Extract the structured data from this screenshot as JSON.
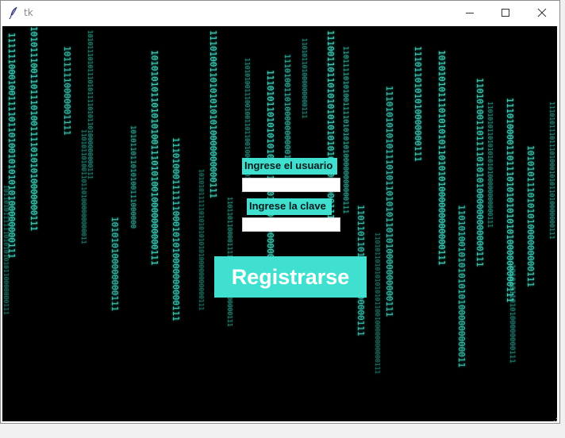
{
  "window": {
    "title": "tk",
    "controls": [
      "minimize-icon",
      "maximize-icon",
      "close-icon"
    ]
  },
  "form": {
    "user_label": "Ingrese el usuario",
    "user_value": "",
    "password_label": "Ingrese la clave",
    "password_value": "",
    "register_label": "Registrarse"
  },
  "background": {
    "style": "binary digital rain",
    "colors": {
      "background": "#000000",
      "digits": "#3fe0c8"
    },
    "columns": [
      "1111110001001111011010010101010100000000111",
      "101011100110111010011110101010000000111",
      "10111110000001111",
      "101011101011101011110101101000000000111",
      "101010100000000111",
      "101011011010100111000000",
      "10101010110101010011101010010000000000111",
      "11101000111111000101010000000000111",
      "11101001101010101010000000000111",
      "1101101100001111010101010000000111",
      "1101010011100100110110010000000111",
      "1110101101010101011010101010000000000111",
      "11101001101000000000011",
      "110101101000000000111",
      "111001101101010101010101000000000111",
      "110111101010011110101010100000000000111",
      "1101101101010100000000111",
      "11101010101011101011010101101010000000000111",
      "1110110101010000000111",
      "10101010111010101011010101000000000000111",
      "1101010010101010101000000000011",
      "110101001101111010101000000000000111",
      "110101011010101010100000000000111",
      "111010000110111010101010101000000000111",
      "101010111010101000000000111",
      "111010111011101000101011010000000111",
      "110101101001101101000000000011",
      "1010101111101010101010100000000000111",
      "10101011010100000000111",
      "1101011010101010101100100000000000111",
      "1011010111111010101010110000000111"
    ]
  }
}
